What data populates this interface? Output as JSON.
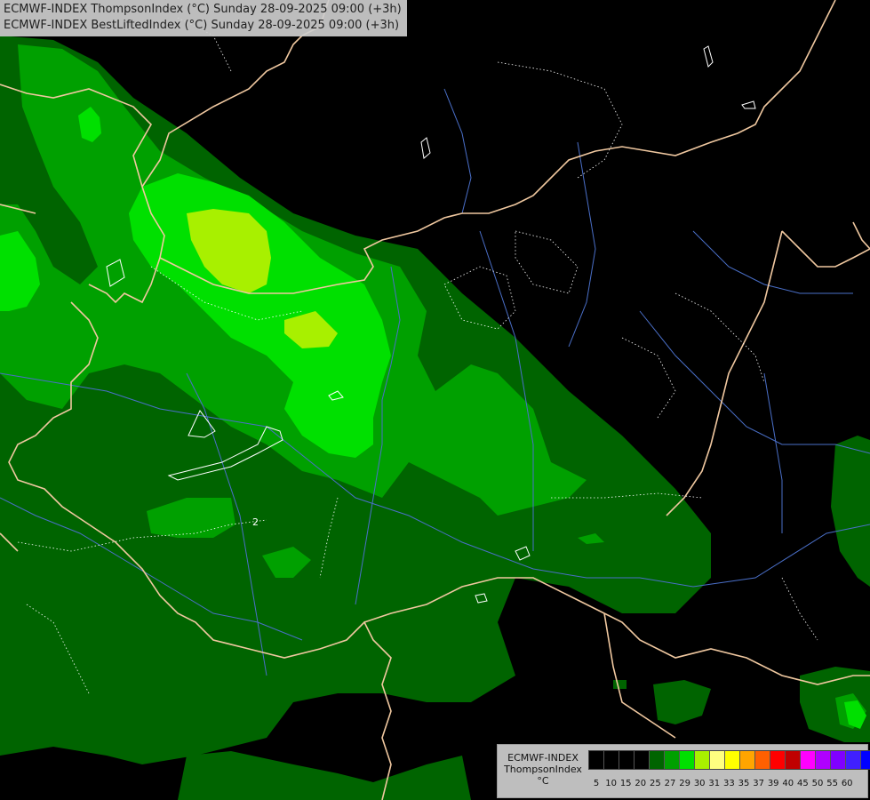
{
  "title_lines": [
    "ECMWF-INDEX ThompsonIndex (°C) Sunday 28-09-2025 09:00 (+3h)",
    "ECMWF-INDEX BestLiftedIndex (°C) Sunday 28-09-2025 09:00 (+3h)"
  ],
  "map": {
    "field_color_levels": [
      {
        "threshold": 20,
        "color": "#006400"
      },
      {
        "threshold": 25,
        "color": "#00a000"
      },
      {
        "threshold": 27,
        "color": "#00e000"
      },
      {
        "threshold": 29,
        "color": "#a8f000"
      }
    ],
    "background_color": "#000000",
    "border_color": "#f0c8a0",
    "river_color": "#4a6fc8",
    "contour_color": "#ffffff",
    "contour_labels": [
      "2"
    ]
  },
  "legend": {
    "title": [
      "ECMWF-INDEX",
      "ThompsonIndex",
      "°C"
    ],
    "colors": [
      "#000000",
      "#000000",
      "#000000",
      "#000000",
      "#006400",
      "#00a000",
      "#00e000",
      "#a8f000",
      "#ffff80",
      "#ffff00",
      "#ffa500",
      "#ff6000",
      "#ff0000",
      "#c00000",
      "#ff00ff",
      "#b000ff",
      "#8000ff",
      "#4020ff",
      "#0000ff"
    ],
    "ticks": [
      "5",
      "10",
      "15",
      "20",
      "25",
      "27",
      "29",
      "30",
      "31",
      "33",
      "35",
      "37",
      "39",
      "40",
      "45",
      "50",
      "55",
      "60"
    ]
  }
}
